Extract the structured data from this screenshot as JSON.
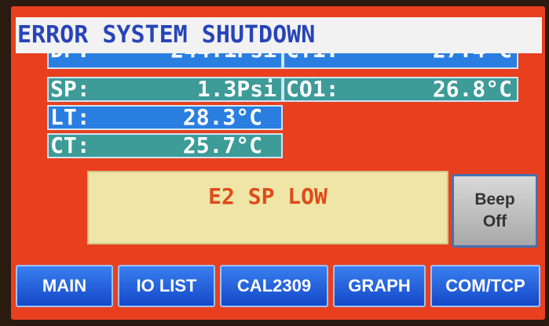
{
  "header": {
    "title": "ERROR SYSTEM SHUTDOWN"
  },
  "readouts": {
    "dp": {
      "label": "DP:",
      "value": "244.1Psi"
    },
    "ct1": {
      "label": "CT1:",
      "value": "27.4°C"
    },
    "sp": {
      "label": "SP:",
      "value": "1.3Psi"
    },
    "co1": {
      "label": "CO1:",
      "value": "26.8°C"
    },
    "lt": {
      "label": "LT:",
      "value": "28.3°C"
    },
    "ct": {
      "label": "CT:",
      "value": "25.7°C"
    }
  },
  "message": {
    "text": "E2 SP LOW"
  },
  "beep_button": {
    "line1": "Beep",
    "line2": "Off"
  },
  "nav": {
    "main": "MAIN",
    "io_list": "IO LIST",
    "cal": "CAL2309",
    "graph": "GRAPH",
    "com": "COM/TCP"
  },
  "colors": {
    "background": "#e8401e",
    "header_text": "#2844b8",
    "readout_blue": "#2a7ee0",
    "readout_teal": "#3d9b98",
    "message_text": "#e04a1a",
    "nav_button": "#1f5ee0"
  }
}
